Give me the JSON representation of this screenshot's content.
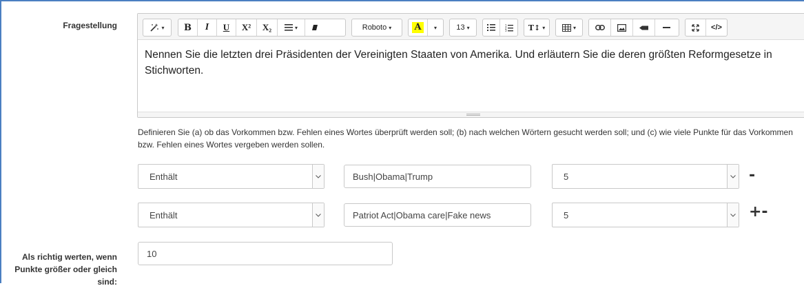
{
  "question": {
    "label": "Fragestellung",
    "content": "Nennen Sie die letzten drei Präsidenten der Vereinigten Staaten von Amerika. Und erläutern Sie die deren größten Reformgesetze in Stichworten."
  },
  "toolbar": {
    "magic_icon": "magic-wand-icon",
    "bold": "B",
    "italic": "I",
    "underline": "U",
    "superscript": "X²",
    "subscript": "X₂",
    "font_name": "Roboto",
    "highlight": "A",
    "font_size": "13",
    "line_height": "T↕",
    "code": "</>"
  },
  "help_text": "Definieren Sie (a) ob das Vorkommen bzw. Fehlen eines Wortes überprüft werden soll; (b) nach welchen Wörtern gesucht werden soll; und (c) wie viele Punkte für das Vorkommen bzw. Fehlen eines Wortes vergeben werden sollen.",
  "rules": [
    {
      "condition": "Enthält",
      "words": "Bush|Obama|Trump",
      "points": "5",
      "controls": "-"
    },
    {
      "condition": "Enthält",
      "words": "Patriot Act|Obama care|Fake news",
      "points": "5",
      "controls": "+-"
    }
  ],
  "threshold": {
    "label": "Als richtig werten, wenn Punkte größer oder gleich sind:",
    "value": "10"
  },
  "colors": {
    "highlight": "#ffff00",
    "frame": "#4a7fc1"
  }
}
